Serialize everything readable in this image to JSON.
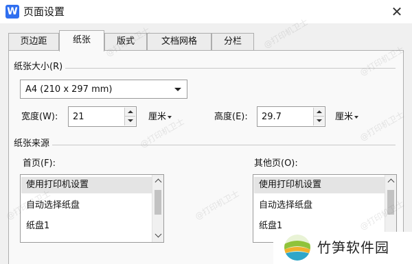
{
  "window": {
    "logo_letter": "W",
    "title": "页面设置",
    "close_glyph": "✕"
  },
  "tabs": [
    {
      "label": "页边距",
      "active": false
    },
    {
      "label": "纸张",
      "active": true
    },
    {
      "label": "版式",
      "active": false
    },
    {
      "label": "文档网格",
      "active": false
    },
    {
      "label": "分栏",
      "active": false
    }
  ],
  "paper_size": {
    "section_label": "纸张大小(R)",
    "selected": "A4 (210 x 297 mm)",
    "width_label": "宽度(W):",
    "width_value": "21",
    "width_unit": "厘米",
    "height_label": "高度(E):",
    "height_value": "29.7",
    "height_unit": "厘米"
  },
  "paper_source": {
    "section_label": "纸张来源",
    "first_page_label": "首页(F):",
    "other_pages_label": "其他页(O):",
    "first_page_items": [
      "使用打印机设置",
      "自动选择纸盘",
      "纸盘1"
    ],
    "other_pages_items": [
      "使用打印机设置",
      "自动选择纸盘",
      "纸盘1"
    ],
    "selected_index": 0
  },
  "watermark_text": "@打印机卫士",
  "brand": {
    "name": "竹笋软件园"
  },
  "colors": {
    "logo_blue": "#2f6ff0",
    "panel_bg": "#f9f9f9",
    "window_bg": "#f0f0f0"
  }
}
